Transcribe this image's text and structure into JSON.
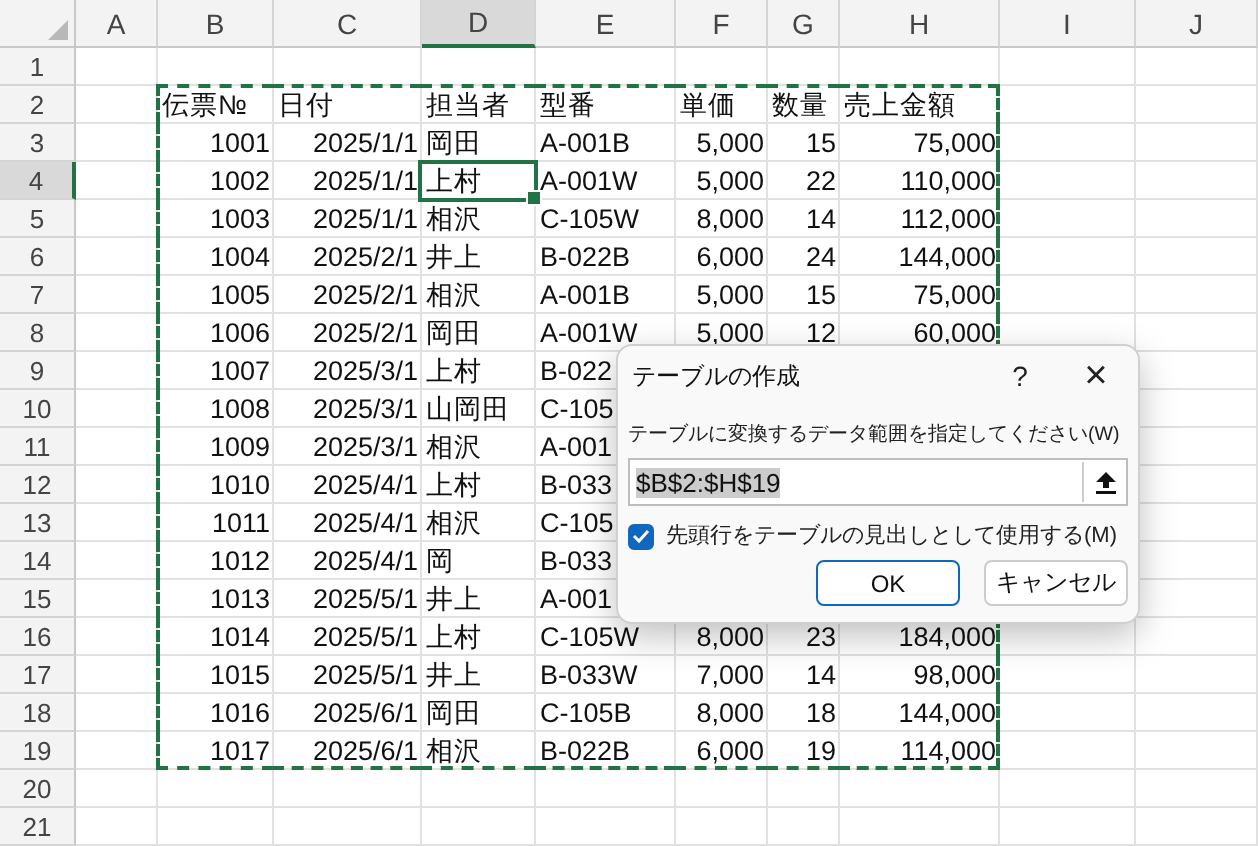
{
  "columns": [
    {
      "label": "A",
      "selected": false,
      "marquee": false
    },
    {
      "label": "B",
      "selected": false,
      "marquee": true
    },
    {
      "label": "C",
      "selected": false,
      "marquee": true
    },
    {
      "label": "D",
      "selected": true,
      "marquee": true
    },
    {
      "label": "E",
      "selected": false,
      "marquee": true
    },
    {
      "label": "F",
      "selected": false,
      "marquee": true
    },
    {
      "label": "G",
      "selected": false,
      "marquee": true
    },
    {
      "label": "H",
      "selected": false,
      "marquee": true
    },
    {
      "label": "I",
      "selected": false,
      "marquee": false
    },
    {
      "label": "J",
      "selected": false,
      "marquee": false
    }
  ],
  "rows": [
    {
      "label": "1",
      "kind": "data",
      "selected": false,
      "marquee": false,
      "cells": []
    },
    {
      "label": "2",
      "kind": "header",
      "selected": false,
      "marquee": true,
      "cells": [
        "",
        "伝票№",
        "日付",
        "担当者",
        "型番",
        "単価",
        "数量",
        "売上金額"
      ]
    },
    {
      "label": "3",
      "kind": "data",
      "selected": false,
      "marquee": true,
      "cells": [
        "",
        "1001",
        "2025/1/1",
        "岡田",
        "A-001B",
        "5,000",
        "15",
        "75,000"
      ]
    },
    {
      "label": "4",
      "kind": "data",
      "selected": true,
      "marquee": true,
      "cells": [
        "",
        "1002",
        "2025/1/1",
        "上村",
        "A-001W",
        "5,000",
        "22",
        "110,000"
      ]
    },
    {
      "label": "5",
      "kind": "data",
      "selected": false,
      "marquee": true,
      "cells": [
        "",
        "1003",
        "2025/1/1",
        "相沢",
        "C-105W",
        "8,000",
        "14",
        "112,000"
      ]
    },
    {
      "label": "6",
      "kind": "data",
      "selected": false,
      "marquee": true,
      "cells": [
        "",
        "1004",
        "2025/2/1",
        "井上",
        "B-022B",
        "6,000",
        "24",
        "144,000"
      ]
    },
    {
      "label": "7",
      "kind": "data",
      "selected": false,
      "marquee": true,
      "cells": [
        "",
        "1005",
        "2025/2/1",
        "相沢",
        "A-001B",
        "5,000",
        "15",
        "75,000"
      ]
    },
    {
      "label": "8",
      "kind": "data",
      "selected": false,
      "marquee": true,
      "cells": [
        "",
        "1006",
        "2025/2/1",
        "岡田",
        "A-001W",
        "5,000",
        "12",
        "60,000"
      ]
    },
    {
      "label": "9",
      "kind": "data",
      "selected": false,
      "marquee": true,
      "cells": [
        "",
        "1007",
        "2025/3/1",
        "上村",
        "B-022"
      ]
    },
    {
      "label": "10",
      "kind": "data",
      "selected": false,
      "marquee": true,
      "cells": [
        "",
        "1008",
        "2025/3/1",
        "山岡田",
        "C-105"
      ]
    },
    {
      "label": "11",
      "kind": "data",
      "selected": false,
      "marquee": true,
      "cells": [
        "",
        "1009",
        "2025/3/1",
        "相沢",
        "A-001"
      ]
    },
    {
      "label": "12",
      "kind": "data",
      "selected": false,
      "marquee": true,
      "cells": [
        "",
        "1010",
        "2025/4/1",
        "上村",
        "B-033"
      ]
    },
    {
      "label": "13",
      "kind": "data",
      "selected": false,
      "marquee": true,
      "cells": [
        "",
        "1011",
        "2025/4/1",
        "相沢",
        "C-105"
      ]
    },
    {
      "label": "14",
      "kind": "data",
      "selected": false,
      "marquee": true,
      "cells": [
        "",
        "1012",
        "2025/4/1",
        "岡",
        "B-033"
      ]
    },
    {
      "label": "15",
      "kind": "data",
      "selected": false,
      "marquee": true,
      "cells": [
        "",
        "1013",
        "2025/5/1",
        "井上",
        "A-001"
      ]
    },
    {
      "label": "16",
      "kind": "data",
      "selected": false,
      "marquee": true,
      "cells": [
        "",
        "1014",
        "2025/5/1",
        "上村",
        "C-105W",
        "8,000",
        "23",
        "184,000"
      ]
    },
    {
      "label": "17",
      "kind": "data",
      "selected": false,
      "marquee": true,
      "cells": [
        "",
        "1015",
        "2025/5/1",
        "井上",
        "B-033W",
        "7,000",
        "14",
        "98,000"
      ]
    },
    {
      "label": "18",
      "kind": "data",
      "selected": false,
      "marquee": true,
      "cells": [
        "",
        "1016",
        "2025/6/1",
        "岡田",
        "C-105B",
        "8,000",
        "18",
        "144,000"
      ]
    },
    {
      "label": "19",
      "kind": "data",
      "selected": false,
      "marquee": true,
      "cells": [
        "",
        "1017",
        "2025/6/1",
        "相沢",
        "B-022B",
        "6,000",
        "19",
        "114,000"
      ]
    },
    {
      "label": "20",
      "kind": "data",
      "selected": false,
      "marquee": false,
      "cells": []
    },
    {
      "label": "21",
      "kind": "data",
      "selected": false,
      "marquee": false,
      "cells": []
    }
  ],
  "dialog": {
    "title": "テーブルの作成",
    "help": "?",
    "close": "×",
    "range_label": "テーブルに変換するデータ範囲を指定してください(W)",
    "range_value": "$B$2:$H$19",
    "header_checkbox": {
      "label": "先頭行をテーブルの見出しとして使用する(M)",
      "checked": true
    },
    "buttons": [
      {
        "label": "OK",
        "kind": "primary"
      },
      {
        "label": "キャンセル",
        "kind": "secondary"
      }
    ]
  }
}
